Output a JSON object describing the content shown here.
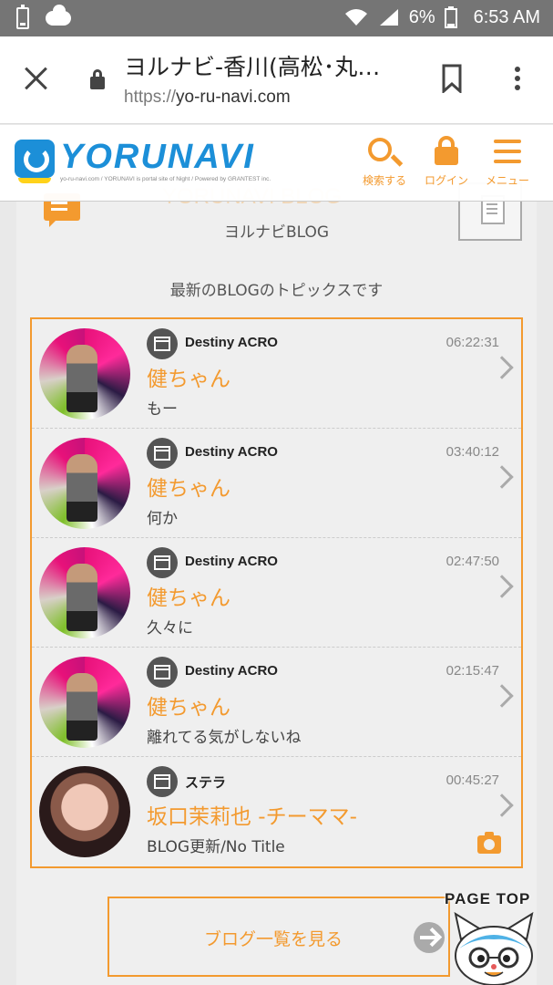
{
  "status_bar": {
    "battery_percent": "6%",
    "time": "6:53 AM"
  },
  "browser": {
    "title": "ヨルナビ-香川(高松･丸…",
    "url_scheme": "https://",
    "url_host": "yo-ru-navi.com"
  },
  "header": {
    "logo_text": "YORUNAVI",
    "logo_tagline": "yo-ru-navi.com / YORUNAVI is portal site of Night / Powered by GRANTEST inc.",
    "search_label": "検索する",
    "login_label": "ログイン",
    "menu_label": "メニュー"
  },
  "section": {
    "watermark": "YORUNAVI BLOG",
    "heading": "ヨルナビBLOG",
    "subtitle": "最新のBLOGのトピックスです"
  },
  "posts": [
    {
      "shop": "Destiny ACRO",
      "time": "06:22:31",
      "author": "健ちゃん",
      "excerpt": "もー"
    },
    {
      "shop": "Destiny ACRO",
      "time": "03:40:12",
      "author": "健ちゃん",
      "excerpt": "何か"
    },
    {
      "shop": "Destiny ACRO",
      "time": "02:47:50",
      "author": "健ちゃん",
      "excerpt": "久々に"
    },
    {
      "shop": "Destiny ACRO",
      "time": "02:15:47",
      "author": "健ちゃん",
      "excerpt": "離れてる気がしないね"
    },
    {
      "shop": "ステラ",
      "time": "00:45:27",
      "author": "坂口茉莉也 -チーママ-",
      "excerpt": "BLOG更新/No Title"
    }
  ],
  "more_link": {
    "label": "ブログ一覧を見る"
  },
  "page_top": {
    "label": "PAGE TOP"
  },
  "colors": {
    "accent": "#f39a2f",
    "brand_blue": "#1c8fd8",
    "status_bar": "#757575"
  }
}
